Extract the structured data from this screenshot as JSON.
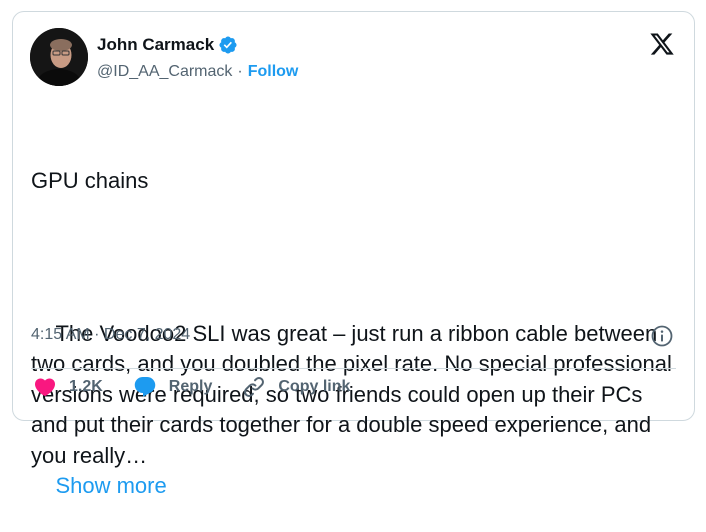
{
  "author": {
    "display_name": "John Carmack",
    "handle": "@ID_AA_Carmack",
    "separator": "·",
    "follow_label": "Follow"
  },
  "tweet": {
    "title_line": "GPU chains",
    "body": "The Voodoo2 SLI was great – just run a ribbon cable between two cards, and you doubled the pixel rate. No special professional versions were required, so two friends could open up their PCs and put their cards together for a double speed experience, and you really…",
    "show_more_label": "Show more",
    "timestamp": "4:15 AM · Dec 7, 2024"
  },
  "actions": {
    "like_count": "1.2K",
    "reply_label": "Reply",
    "copy_link_label": "Copy link"
  },
  "colors": {
    "accent": "#1d9bf0",
    "like": "#f91880",
    "muted": "#536471",
    "text": "#0f1419"
  },
  "icons": {
    "verified": "verified-badge-icon",
    "brand": "x-logo-icon",
    "info": "info-icon",
    "like": "heart-icon",
    "reply": "speech-bubble-icon",
    "copy_link": "link-icon"
  }
}
